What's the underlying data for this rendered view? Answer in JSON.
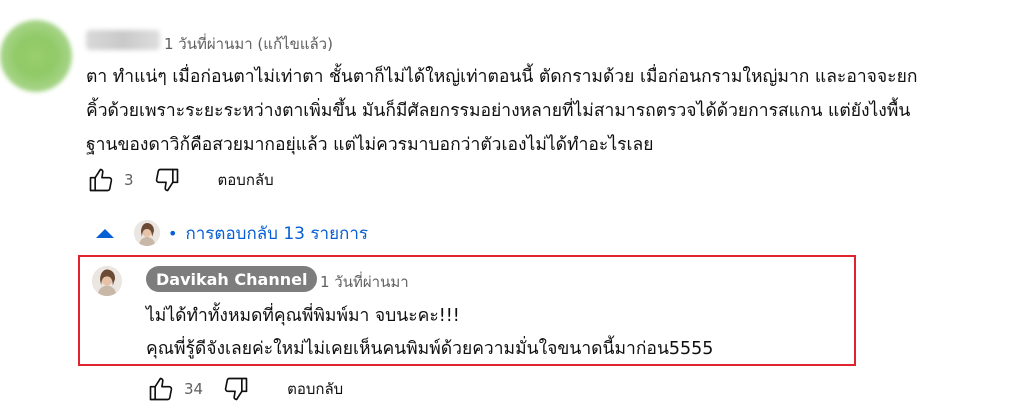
{
  "comment": {
    "timestamp": "1 วันที่ผ่านมา (แก้ไขแล้ว)",
    "lines": [
      "ตา ทำแน่ๆ เมื่อก่อนตาไม่เท่าตา ชั้นตาก็ไม่ได้ใหญ่เท่าตอนนี้ ตัดกรามด้วย เมื่อก่อนกรามใหญ่มาก และอาจจะยก",
      "คิ้วด้วยเพราะระยะระหว่างตาเพิ่มขึ้น มันก็มีศัลยกรรมอย่างหลายที่ไม่สามารถตรวจได้ด้วยการสแกน แต่ยังไงพื้น",
      "ฐานของดาวิก้คือสวยมากอยุ่แล้ว แต่ไม่ควรมาบอกว่าตัวเองไม่ได้ทำอะไรเลย"
    ],
    "like_count": "3",
    "reply_label": "ตอบกลับ"
  },
  "replies_toggle": {
    "dot": "•",
    "label": "การตอบกลับ 13 รายการ"
  },
  "reply": {
    "author": "Davikah Channel",
    "timestamp": "1 วันที่ผ่านมา",
    "lines": [
      "ไม่ได้ทำทั้งหมดที่คุณพี่พิมพ์มา จบนะคะ!!!",
      "คุณพี่รู้ดีจังเลยค่ะใหม่ไม่เคยเห็นคนพิมพ์ด้วยความมั่นใจขนาดนี้มาก่อน5555"
    ],
    "like_count": "34",
    "reply_label": "ตอบกลับ"
  },
  "colors": {
    "link_blue": "#065fd4",
    "highlight_red": "#e0242f",
    "badge_gray": "#7d7d7d"
  }
}
